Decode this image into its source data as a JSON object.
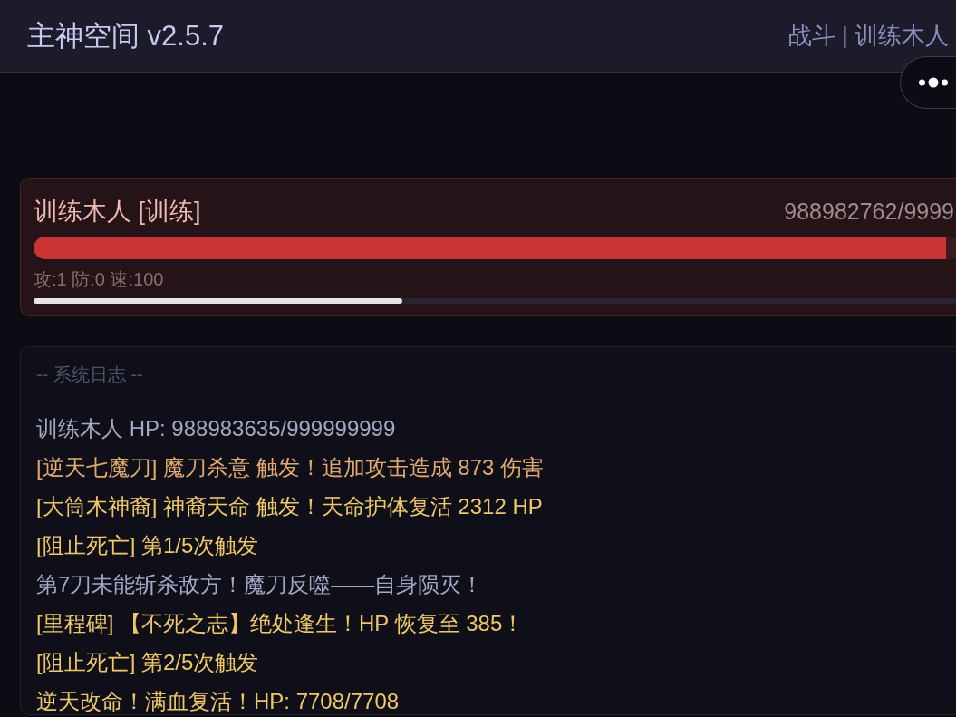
{
  "header": {
    "title": "主神空间 v2.5.7",
    "breadcrumb": "战斗 | 训练木人"
  },
  "enemy": {
    "name": "训练木人 [训练]",
    "hp_reading": "988982762/9999",
    "hp_bar": {
      "level": 0.989
    },
    "stats": "攻:1 防:0 速:100",
    "progress_bar": {
      "level": 0.4
    }
  },
  "log": {
    "title": "-- 系统日志 --",
    "entries": [
      {
        "text": "训练木人 HP: 988983635/999999999",
        "color": "#a3a7c4"
      },
      {
        "text": "[逆天七魔刀] 魔刀杀意 触发！追加攻击造成 873 伤害",
        "color": "#e3aa6c"
      },
      {
        "text": "[大筒木神裔] 神裔天命 触发！天命护体复活 2312 HP",
        "color": "#f0c763"
      },
      {
        "text": "[阻止死亡] 第1/5次触发",
        "color": "#f0c763"
      },
      {
        "text": "第7刀未能斩杀敌方！魔刀反噬——自身陨灭！",
        "color": "#a3a7c4"
      },
      {
        "text": "[里程碑] 【不死之志】绝处逢生！HP 恢复至 385！",
        "color": "#f0c763"
      },
      {
        "text": "[阻止死亡] 第2/5次触发",
        "color": "#f0c763"
      },
      {
        "text": "逆天改命！满血复活！HP: 7708/7708",
        "color": "#f0c763"
      }
    ]
  }
}
